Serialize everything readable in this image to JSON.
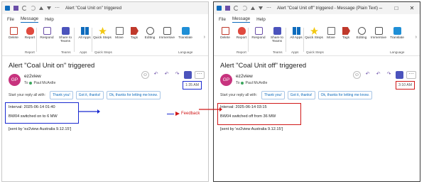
{
  "left": {
    "title": "Alert \"Coal Unit on\" triggered",
    "subject": "Alert \"Coal Unit on\" triggered",
    "time": "1:35 AM",
    "interval": "Interval: 2025-06-14 01:40",
    "status_line": "BW04 switched on to 6 MW"
  },
  "right": {
    "title": "Alert \"Coal Unit off\" triggered  -  Message (Plain Text)",
    "subject": "Alert \"Coal Unit off\" triggered",
    "time": "3:10 AM",
    "interval": "Interval: 2025-06-14 03:15",
    "status_line": "BW04 switched off from 36 MW"
  },
  "common": {
    "menu": [
      "File",
      "Message",
      "Help"
    ],
    "ribbon": {
      "delete": "Delete",
      "report": "Report",
      "respond": "Respond",
      "share": "Share to Teams",
      "apps": "All Apps",
      "quick_steps": "Quick Steps",
      "move": "Move",
      "tags": "Tags",
      "editing": "Editing",
      "immersive": "Immersive",
      "translate": "Translate",
      "groups": {
        "report": "Report",
        "teams": "Teams",
        "apps": "Apps",
        "quick_steps": "Quick Steps",
        "language": "Language"
      }
    },
    "avatar_initials": "GP",
    "sender": "ez2view",
    "to_label": "To",
    "recipient": "Paul McArdle",
    "reply_prompt": "Start your reply all with:",
    "quick_replies": [
      "Thank you!",
      "Got it, thanks!",
      "Ok, thanks for letting me know."
    ],
    "feedback": "Feedback",
    "sent_by": "[sent by 'ez2view Australia 9.12.15']"
  },
  "colors": {
    "left_highlight": "#1a2ad0",
    "right_highlight": "#d01818",
    "avatar": "#c7337e",
    "link": "#0f6cbd"
  }
}
